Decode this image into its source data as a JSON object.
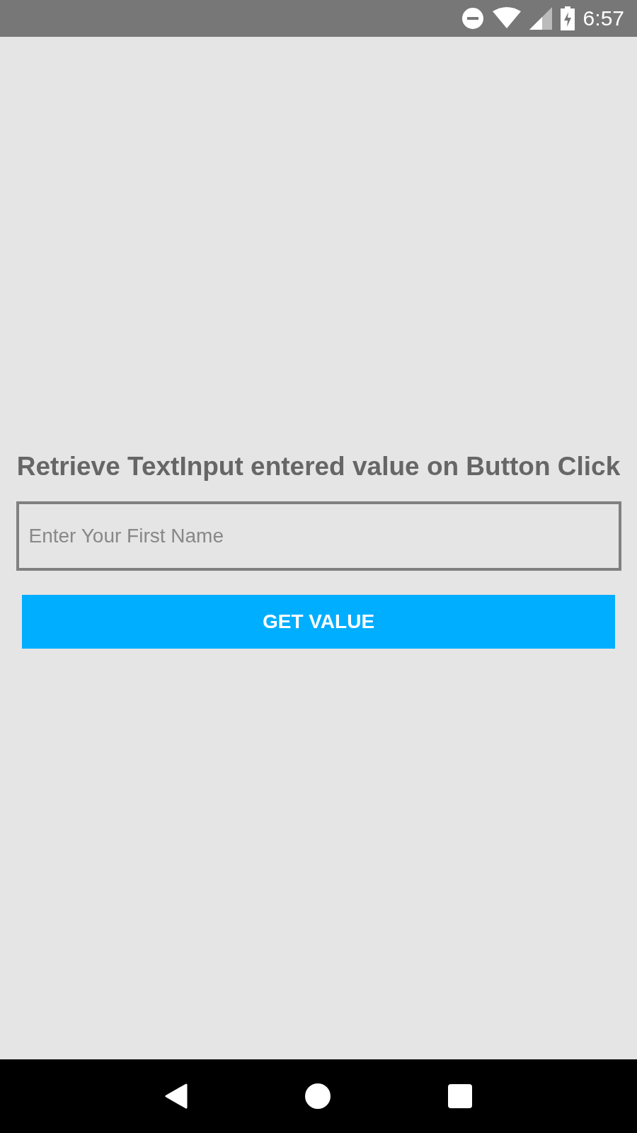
{
  "status_bar": {
    "time": "6:57"
  },
  "title": "Retrieve TextInput entered value on Button Click",
  "name_field": {
    "placeholder": "Enter Your First Name"
  },
  "button": {
    "label": "GET VALUE"
  }
}
